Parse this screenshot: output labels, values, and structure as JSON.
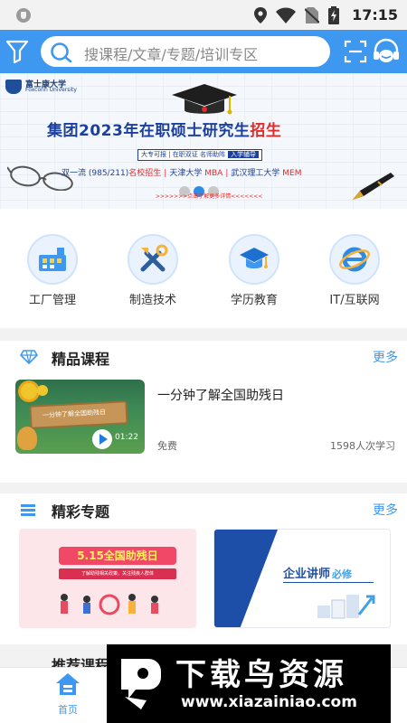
{
  "status_bar": {
    "time": "17:15"
  },
  "search": {
    "placeholder": "搜课程/文章/专题/培训专区"
  },
  "banner": {
    "university_name": "富士康大学",
    "university_subtitle": "Foxconn University",
    "headline_prefix": "集团2023年在职硕士研究生",
    "headline_highlight": "招生",
    "tagline": "大专可报 | 在职双证  名师助阵",
    "tagline_badge": "入学辅导",
    "school_1_prefix": "双一流 (985/211)",
    "school_1_highlight": "名校招生",
    "school_2_prefix": "天津大学",
    "school_2_highlight": "MBA",
    "school_3_prefix": "武汉理工大学",
    "school_3_highlight": "MEM",
    "footnote": ">>>>>>>点击了解更多详情<<<<<<<",
    "carousel_total": 3,
    "carousel_active": 2
  },
  "categories": [
    {
      "label": "工厂管理",
      "icon": "factory-icon"
    },
    {
      "label": "制造技术",
      "icon": "tools-icon"
    },
    {
      "label": "学历教育",
      "icon": "graduation-cap-icon"
    },
    {
      "label": "IT/互联网",
      "icon": "internet-explorer-icon"
    }
  ],
  "featured_courses": {
    "title": "精品课程",
    "more": "更多",
    "items": [
      {
        "title": "一分钟了解全国助残日",
        "thumb_text": "一分钟了解全国助残日",
        "duration": "01:22",
        "price": "免费",
        "learners": "1598人次学习"
      }
    ]
  },
  "topics": {
    "title": "精彩专题",
    "more": "更多",
    "items": [
      {
        "heading": "5.15全国助残日",
        "subheading": "了解助残相关政策，关注残疾人群体"
      },
      {
        "heading": "企业讲师",
        "heading_alt": "必修"
      }
    ]
  },
  "next_section": {
    "title": "推荐课程"
  },
  "bottom_nav": {
    "home_label": "首页"
  },
  "watermark": {
    "title": "下载鸟资源",
    "url": "www.xiazainiao.com"
  },
  "colors": {
    "primary": "#3f98f0",
    "banner_headline": "#1a3f9c",
    "banner_highlight": "#e22b2b"
  }
}
